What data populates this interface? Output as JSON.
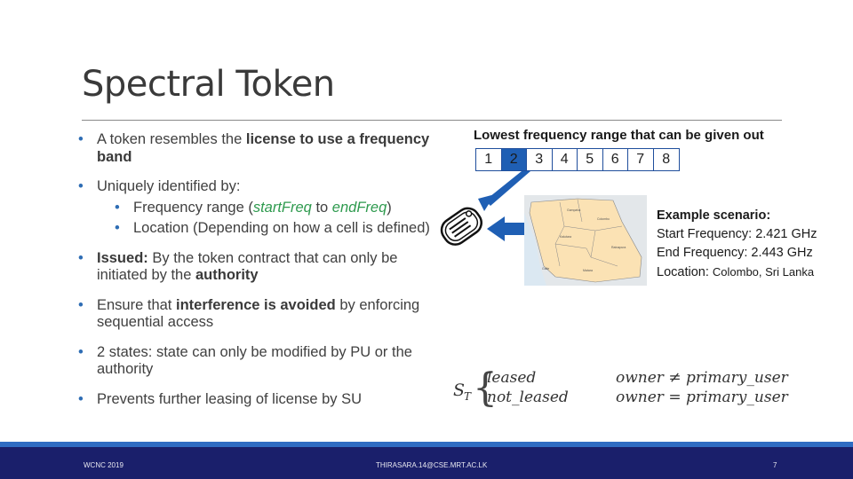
{
  "slide": {
    "title": "Spectral Token",
    "bullets": {
      "b1_pre": "A token resembles the ",
      "b1_bold": "license to use a frequency band",
      "b2": "Uniquely identified by:",
      "b2_sub1_pre": "Frequency range (",
      "b2_sub1_start": "startFreq",
      "b2_sub1_mid": " to ",
      "b2_sub1_end": "endFreq",
      "b2_sub1_post": ")",
      "b2_sub2": "Location (Depending on how a cell is defined)",
      "b3_bold1": "Issued:",
      "b3_mid": " By the token contract that can only be initiated by the ",
      "b3_bold2": "authority",
      "b4_pre": "Ensure that ",
      "b4_bold": "interference is avoided",
      "b4_post": " by enforcing sequential access",
      "b5": "2 states: state can only be modified by PU or the authority",
      "b6": "Prevents further leasing of license by SU"
    },
    "frequency": {
      "heading": "Lowest frequency range that can be given out",
      "cells": [
        "1",
        "2",
        "3",
        "4",
        "5",
        "6",
        "7",
        "8"
      ],
      "selected": "2"
    },
    "scenario": {
      "heading": "Example scenario:",
      "start": "Start Frequency: 2.421 GHz",
      "end": "End Frequency:  2.443 GHz",
      "location_label": "Location: ",
      "location_value": "Colombo, Sri Lanka"
    },
    "formula": {
      "symbol": "S",
      "subscript": "T",
      "state1": "leased",
      "state2": "not_leased",
      "cond1": "owner ≠ primary_user",
      "cond2": "owner = primary_user"
    },
    "colors": {
      "accent": "#1f5fb4",
      "footer_bg": "#1a1f6b",
      "footer_stripe": "#2f6cc2",
      "highlight_green": "#2e9a4e"
    }
  },
  "footer": {
    "left": "WCNC 2019",
    "center": "THIRASARA.14@CSE.MRT.AC.LK",
    "page": "7"
  }
}
